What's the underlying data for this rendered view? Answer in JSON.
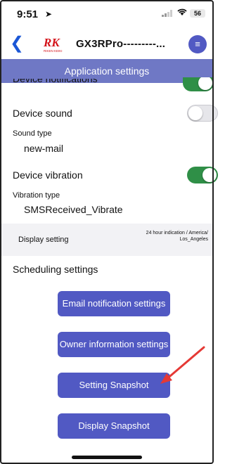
{
  "status_bar": {
    "time": "9:51",
    "battery": "56"
  },
  "header": {
    "device_name": "GX3RPro---------...",
    "logo_text": "RK",
    "logo_sub": "RIKEN KEIKI"
  },
  "page_title": "Application settings",
  "settings": {
    "device_notifications_label": "Device notifications",
    "device_sound_label": "Device sound",
    "sound_type_label": "Sound type",
    "sound_type_value": "new-mail",
    "device_vibration_label": "Device vibration",
    "vibration_type_label": "Vibration type",
    "vibration_type_value": "SMSReceived_Vibrate",
    "display_setting_label": "Display setting",
    "display_setting_value_line1": "24 hour indication / America/",
    "display_setting_value_line2": "Los_Angeles",
    "scheduling_settings_label": "Scheduling settings"
  },
  "toggles": {
    "device_notifications": true,
    "device_sound": false,
    "device_vibration": true
  },
  "buttons": {
    "email_notification": "Email notification settings",
    "owner_information": "Owner information settings",
    "setting_snapshot": "Setting Snapshot",
    "display_snapshot": "Display Snapshot"
  },
  "colors": {
    "accent": "#5159c3",
    "title_bar": "#6f78c5",
    "toggle_on": "#2f8f47",
    "annotation_arrow": "#e53935"
  }
}
